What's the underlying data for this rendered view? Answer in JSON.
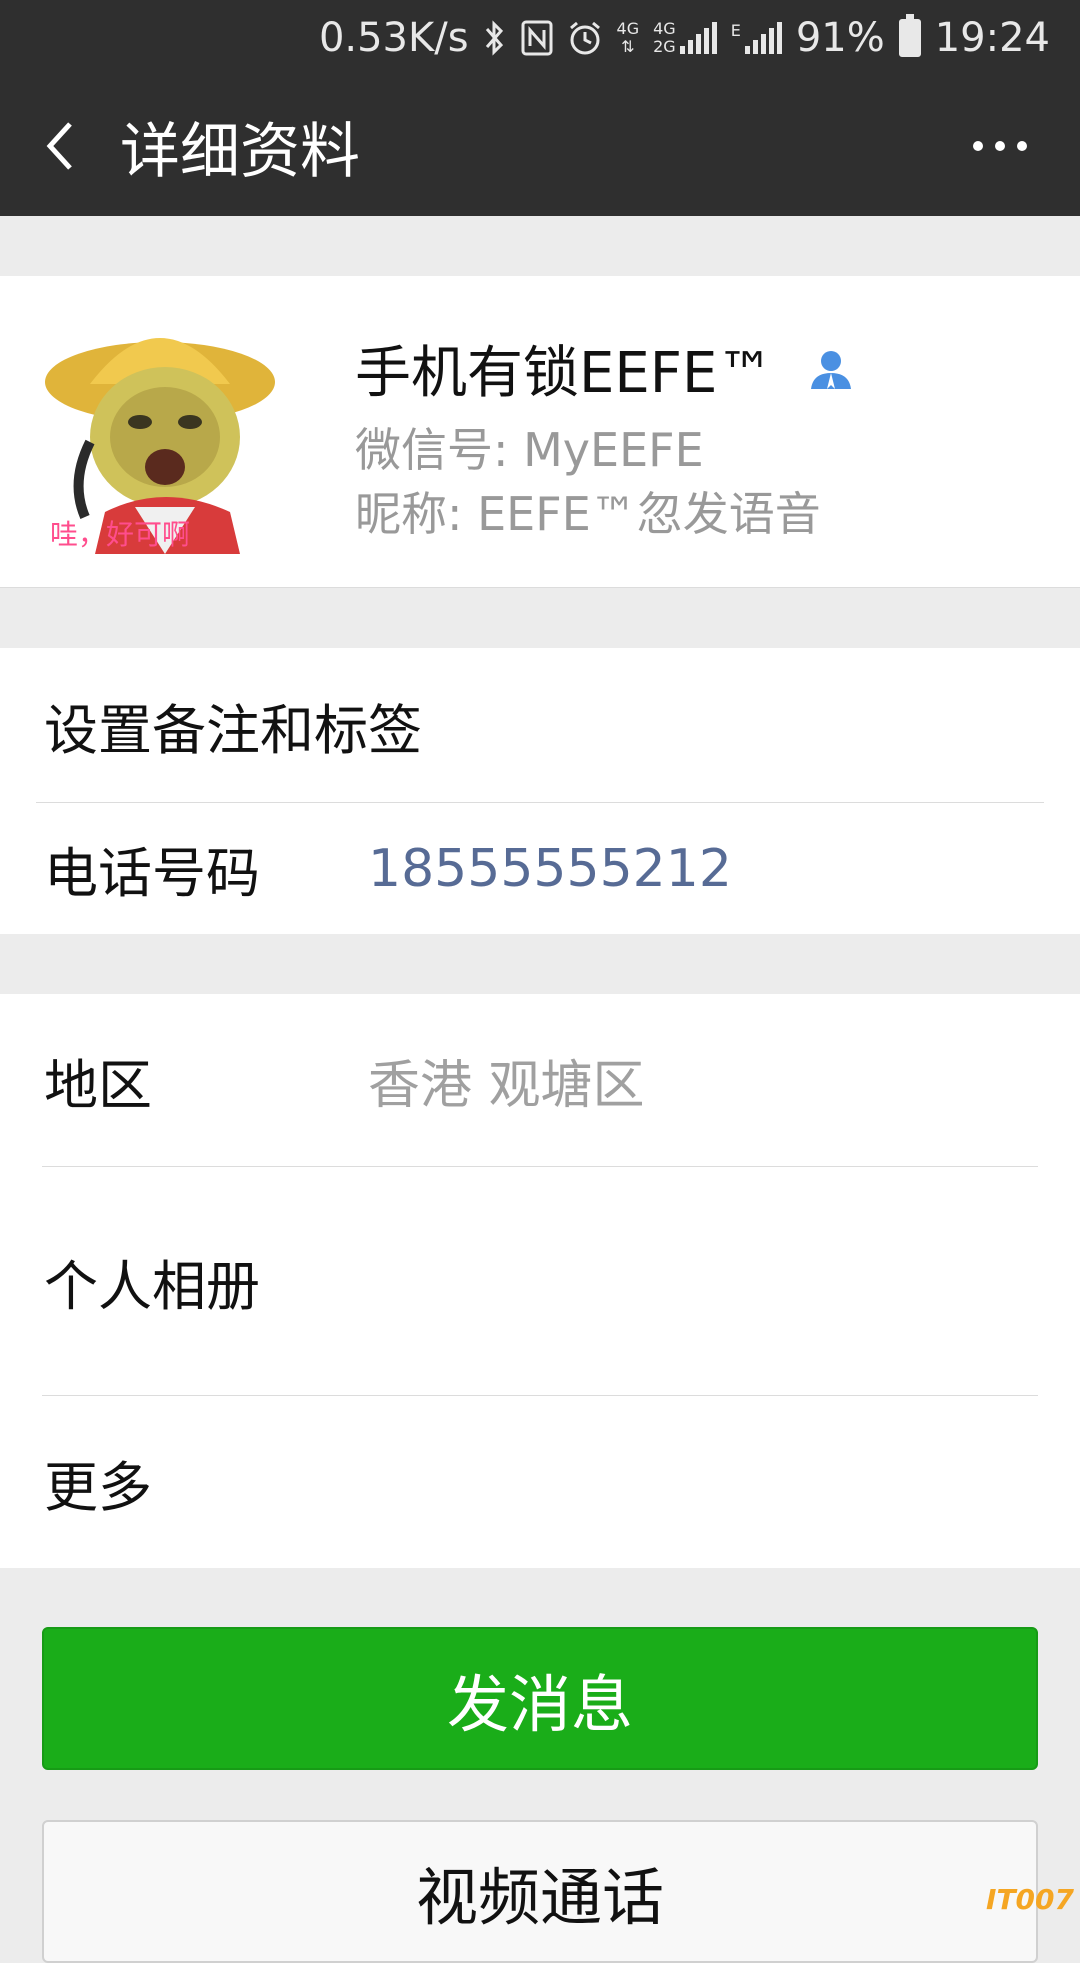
{
  "status_bar": {
    "network_speed": "0.53K/s",
    "net1": "4G",
    "net2a": "4G",
    "net2b": "2G",
    "net3": "E",
    "battery": "91%",
    "time": "19:24"
  },
  "header": {
    "title": "详细资料"
  },
  "profile": {
    "name": "手机有锁EEFE™",
    "wechat_id": "微信号: MyEEFE",
    "nickname": "昵称: EEFE™忽发语音",
    "avatar_caption": "哇，好可啊"
  },
  "rows": {
    "remark_label": "设置备注和标签",
    "phone_label": "电话号码",
    "phone_value": "18555555212",
    "region_label": "地区",
    "region_value": "香港  观塘区",
    "album_label": "个人相册",
    "more_label": "更多"
  },
  "buttons": {
    "send_message": "发消息",
    "video_call": "视频通话"
  },
  "watermark": "IT007",
  "colors": {
    "header_bg": "#2f2f2f",
    "primary_green": "#1aad19",
    "link_blue": "#576b95",
    "contact_icon": "#4a90e2"
  }
}
